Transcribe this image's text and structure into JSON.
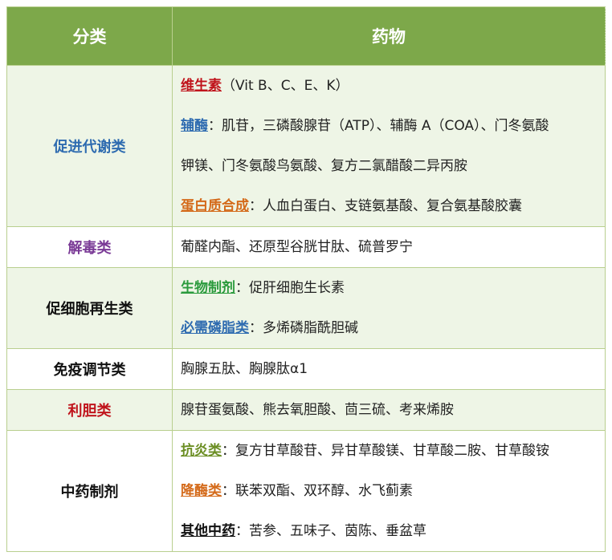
{
  "header": {
    "category": "分类",
    "drug": "药物"
  },
  "colors": {
    "header_bg": "#7da84a",
    "band_bg": "#eef5e6",
    "red": "#c0141c",
    "blue": "#2e6bb0",
    "orange": "#d46a1a",
    "green": "#2a9a3c",
    "olive": "#6b8e23",
    "purple": "#7a3a96"
  },
  "rows": [
    {
      "category": "促进代谢类",
      "lines": [
        {
          "kw": "维生素",
          "text": "（Vit B、C、E、K）"
        },
        {
          "kw": "辅酶",
          "text": "：肌苷，三磷酸腺苷（ATP）、辅酶 A（COA）、门冬氨酸"
        },
        {
          "kw": "",
          "text": "钾镁、门冬氨酸鸟氨酸、复方二氯醋酸二异丙胺"
        },
        {
          "kw": "蛋白质合成",
          "text": "：人血白蛋白、支链氨基酸、复合氨基酸胶囊"
        }
      ]
    },
    {
      "category": "解毒类",
      "lines": [
        {
          "kw": "",
          "text": "葡醛内酯、还原型谷胱甘肽、硫普罗宁"
        }
      ]
    },
    {
      "category": "促细胞再生类",
      "lines": [
        {
          "kw": "生物制剂",
          "text": "：促肝细胞生长素"
        },
        {
          "kw": "必需磷脂类",
          "text": "：多烯磷脂酰胆碱"
        }
      ]
    },
    {
      "category": "免疫调节类",
      "lines": [
        {
          "kw": "",
          "text": "胸腺五肽、胸腺肽α1"
        }
      ]
    },
    {
      "category": "利胆类",
      "lines": [
        {
          "kw": "",
          "text": "腺苷蛋氨酸、熊去氧胆酸、茴三硫、考来烯胺"
        }
      ]
    },
    {
      "category": "中药制剂",
      "lines": [
        {
          "kw": "抗炎类",
          "text": "：复方甘草酸苷、异甘草酸镁、甘草酸二胺、甘草酸铵"
        },
        {
          "kw": "降酶类",
          "text": "：联苯双酯、双环醇、水飞蓟素"
        },
        {
          "kw": "其他中药",
          "text": "：苦参、五味子、茵陈、垂盆草"
        }
      ]
    }
  ]
}
